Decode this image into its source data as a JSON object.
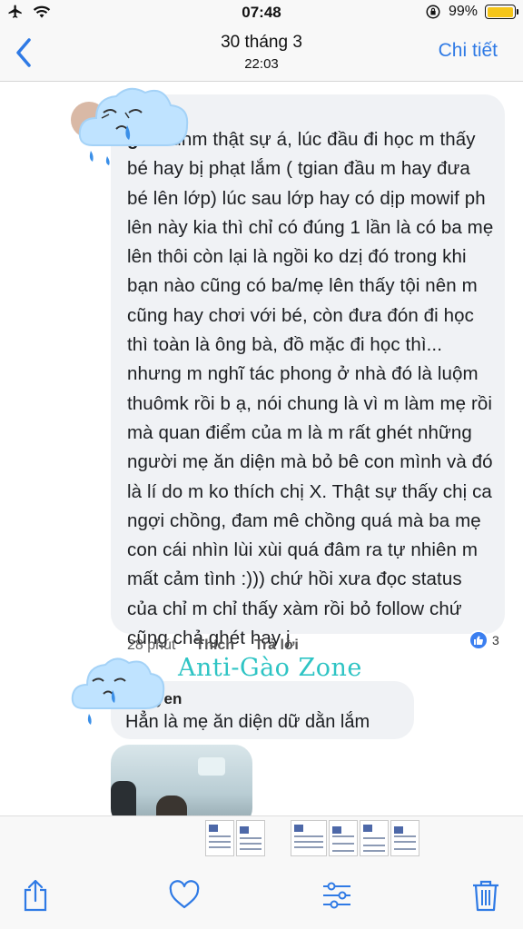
{
  "status_bar": {
    "time": "07:48",
    "battery_percent": "99%",
    "battery_level": 0.99,
    "icons": [
      "airplane-icon",
      "wifi-icon",
      "orientation-lock-icon",
      "battery-icon"
    ]
  },
  "nav": {
    "back_icon": "chevron-left-icon",
    "title": "30 tháng 3",
    "subtitle": "22:03",
    "detail_label": "Chi tiết"
  },
  "comment1": {
    "author_partial": "g Lê",
    "text": "uhm thật sự á, lúc đầu đi học m thấy bé hay bị phạt lắm ( tgian đầu m hay đưa bé lên lớp) lúc sau lớp hay có dịp mowif ph lên này kia thì chỉ có đúng 1 lần là có ba mẹ lên thôi còn lại là ngồi ko dzị đó trong khi bạn nào cũng có ba/mẹ lên thấy tội nên m cũng hay chơi với bé, còn đưa đón đi học thì toàn là ông bà, đồ mặc đi học thì... nhưng m nghĩ tác phong ở nhà đó là luộm thuômk rồi b ạ, nói chung là vì m làm mẹ rồi mà quan điểm của m là m rất ghét những người mẹ ăn diện mà bỏ bê con mình và đó là lí do m ko thích chị X. Thật sự thấy chị ca ngợi chồng, đam mê chồng quá mà ba mẹ con cái nhìn lùi xùi quá đâm ra tự nhiên m mất cảm tình :))) chứ hồi xưa đọc status của chỉ m chỉ thấy xàm rồi bỏ follow chứ cũng chả ghét hay j",
    "time_ago": "28 phút",
    "like_label": "Thích",
    "reply_label": "Trả lời",
    "reaction_count": "3"
  },
  "watermark": "Anti-Gào Zone",
  "comment2": {
    "author_partial": "Nguyen",
    "text": "Hẳn là mẹ ăn diện dữ dằn lắm"
  },
  "toolbar": {
    "icons": [
      "share-icon",
      "heart-icon",
      "adjust-icon",
      "trash-icon"
    ]
  },
  "colors": {
    "ios_blue": "#2f7ae5",
    "bubble_bg": "#f0f2f5",
    "watermark": "#2ec4c4",
    "like_blue": "#3b7ff0"
  }
}
